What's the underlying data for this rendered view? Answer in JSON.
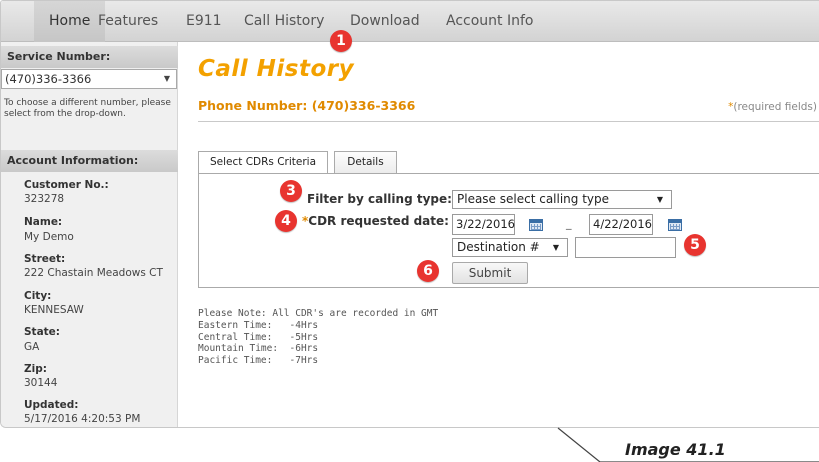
{
  "nav": {
    "tabs": [
      {
        "label": "Home"
      },
      {
        "label": "Features"
      },
      {
        "label": "E911"
      },
      {
        "label": "Call History"
      },
      {
        "label": "Download"
      },
      {
        "label": "Account Info"
      }
    ]
  },
  "sidebar": {
    "service_header": "Service Number:",
    "selected_number": "(470)336-3366",
    "note": "To choose a different number, please select from the drop-down.",
    "account_header": "Account Information:",
    "fields": [
      {
        "label": "Customer No.:",
        "value": "323278"
      },
      {
        "label": "Name:",
        "value": "My Demo"
      },
      {
        "label": "Street:",
        "value": "222 Chastain Meadows CT"
      },
      {
        "label": "City:",
        "value": "KENNESAW"
      },
      {
        "label": "State:",
        "value": "GA"
      },
      {
        "label": "Zip:",
        "value": "30144"
      },
      {
        "label": "Updated:",
        "value": "5/17/2016 4:20:53 PM"
      }
    ]
  },
  "main": {
    "title": "Call History",
    "phone_line": "Phone Number: (470)336-3366",
    "required_asterisk": "*",
    "required_note": "(required fields)",
    "criteria_tabs": [
      {
        "label": "Select CDRs Criteria"
      },
      {
        "label": "Details"
      }
    ],
    "filter_label": "Filter by calling type:",
    "filter_value": "Please select calling type",
    "date_label_asterisk": "*",
    "date_label": "CDR requested date:",
    "date_from": "3/22/2016",
    "date_to": "4/22/2016",
    "date_separator": "_",
    "destination_select": "Destination #",
    "destination_input": "",
    "submit_label": "Submit",
    "gmt_note": "Please Note: All CDR's are recorded in GMT\nEastern Time:   -4Hrs\nCentral Time:   -5Hrs\nMountain Time:  -6Hrs\nPacific Time:   -7Hrs"
  },
  "callouts": [
    "1",
    "3",
    "4",
    "5",
    "6"
  ],
  "caption": "Image 41.1",
  "colors": {
    "accent_orange": "#f3a100",
    "callout_red": "#e8342f"
  }
}
